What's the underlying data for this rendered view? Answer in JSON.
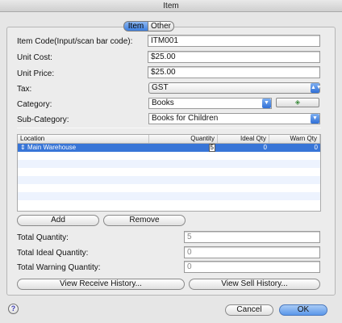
{
  "window": {
    "title": "Item"
  },
  "tabs": {
    "item": "Item",
    "other": "Other"
  },
  "form": {
    "item_code_label": "Item Code(Input/scan bar code):",
    "item_code_value": "ITM001",
    "unit_cost_label": "Unit Cost:",
    "unit_cost_value": "$25.00",
    "unit_price_label": "Unit Price:",
    "unit_price_value": "$25.00",
    "tax_label": "Tax:",
    "tax_value": "GST",
    "category_label": "Category:",
    "category_value": "Books",
    "subcategory_label": "Sub-Category:",
    "subcategory_value": "Books for Children"
  },
  "table": {
    "headers": {
      "location": "Location",
      "quantity": "Quantity",
      "ideal_qty": "Ideal Qty",
      "warn_qty": "Warn Qty"
    },
    "rows": [
      {
        "location": "Main Warehouse",
        "quantity": "5",
        "ideal_qty": "0",
        "warn_qty": "0"
      }
    ]
  },
  "actions": {
    "add": "Add",
    "remove": "Remove"
  },
  "totals": {
    "total_quantity_label": "Total Quantity:",
    "total_quantity_value": "5",
    "total_ideal_label": "Total Ideal Quantity:",
    "total_ideal_value": "0",
    "total_warning_label": "Total Warning Quantity:",
    "total_warning_value": "0"
  },
  "history": {
    "receive": "View Receive History...",
    "sell": "View Sell History..."
  },
  "footer": {
    "help": "?",
    "cancel": "Cancel",
    "ok": "OK"
  }
}
